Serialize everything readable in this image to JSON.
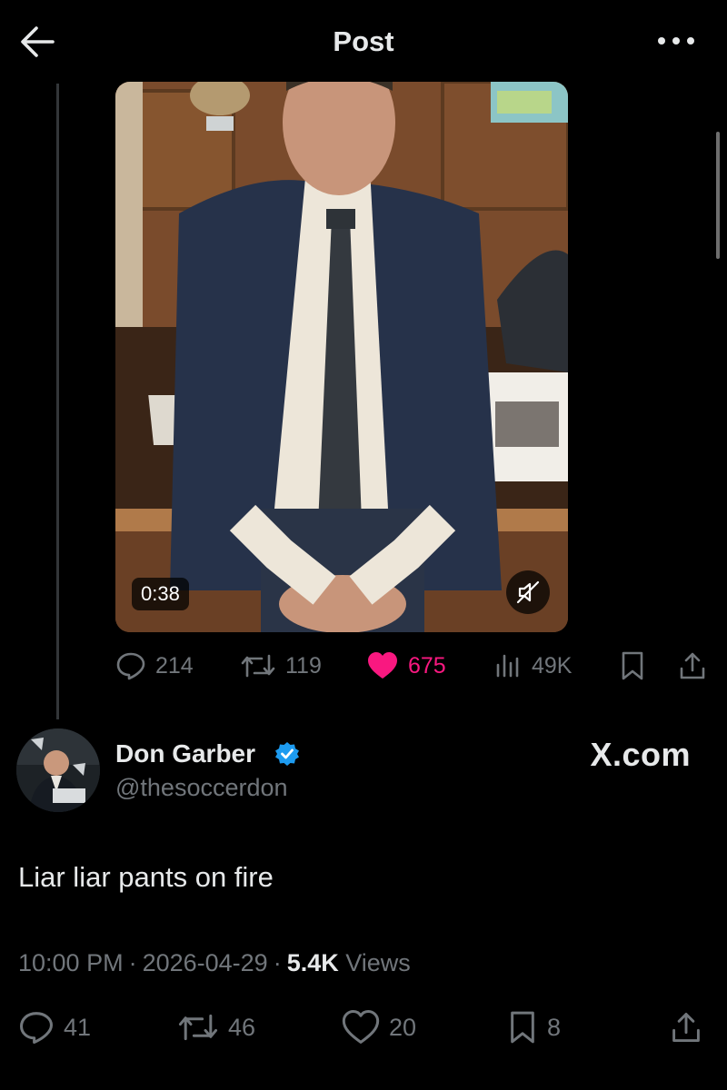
{
  "header": {
    "title": "Post",
    "back_icon": "arrow-left-icon",
    "more_icon": "more-horizontal-icon"
  },
  "media": {
    "duration": "0:38",
    "mute_icon": "muted-speaker-icon"
  },
  "quoted_actions": {
    "replies": "214",
    "reposts": "119",
    "likes": "675",
    "views": "49K"
  },
  "author": {
    "name": "Don Garber",
    "handle": "@thesoccerdon",
    "verified": true
  },
  "watermark": "X.com",
  "post": {
    "text": "Liar liar pants on fire",
    "time": "10:00 PM",
    "date": "2026-04-29",
    "views_count": "5.4K",
    "views_label": "Views"
  },
  "post_actions": {
    "replies": "41",
    "reposts": "46",
    "likes": "20",
    "bookmarks": "8"
  },
  "colors": {
    "background": "#000000",
    "text": "#e7e9ea",
    "muted": "#71767b",
    "like": "#f91880",
    "verified": "#1d9bf0"
  }
}
